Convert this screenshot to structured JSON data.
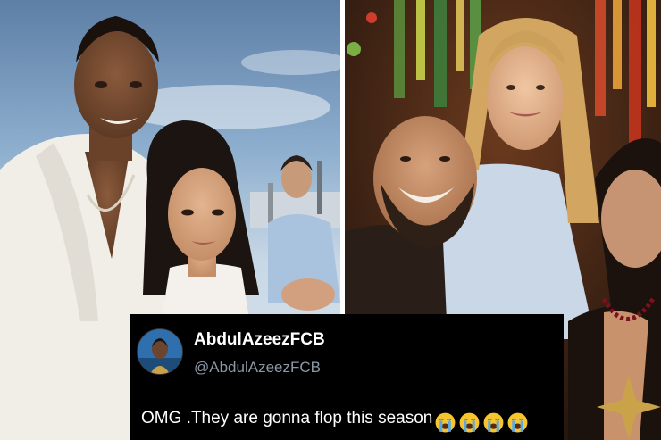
{
  "tweet": {
    "display_name": "AbdulAzeezFCB",
    "handle": "@AbdulAzeezFCB",
    "text": "OMG .They are gonna flop this season",
    "emoji_icons": [
      "crying-face-icon",
      "crying-face-icon",
      "crying-face-icon",
      "crying-face-icon"
    ]
  },
  "colors": {
    "tweet_background": "#000000",
    "tweet_text": "#ffffff",
    "handle_text": "#8b98a5",
    "emoji_face": "#f7c62f",
    "emoji_tears": "#5aa9e6"
  }
}
